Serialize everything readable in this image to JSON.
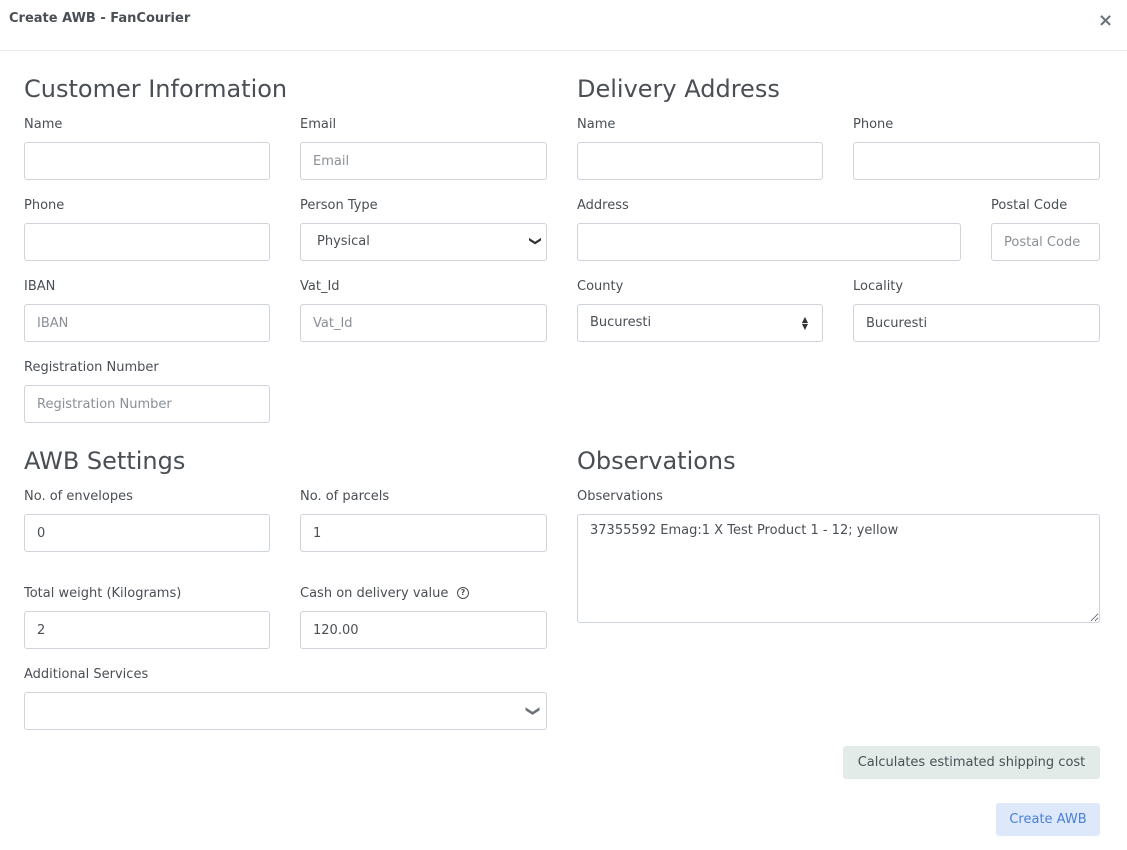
{
  "modal": {
    "title": "Create AWB - FanCourier",
    "close_icon": "×"
  },
  "customer": {
    "heading": "Customer Information",
    "name_label": "Name",
    "name_value": "",
    "email_label": "Email",
    "email_placeholder": "Email",
    "phone_label": "Phone",
    "phone_value": "",
    "person_type_label": "Person Type",
    "person_type_value": "Physical",
    "iban_label": "IBAN",
    "iban_placeholder": "IBAN",
    "vat_label": "Vat_Id",
    "vat_placeholder": "Vat_Id",
    "reg_label": "Registration Number",
    "reg_placeholder": "Registration Number"
  },
  "delivery": {
    "heading": "Delivery Address",
    "name_label": "Name",
    "name_value": "",
    "phone_label": "Phone",
    "phone_value": "",
    "address_label": "Address",
    "address_value": "",
    "postal_label": "Postal Code",
    "postal_placeholder": "Postal Code",
    "county_label": "County",
    "county_value": "Bucuresti",
    "locality_label": "Locality",
    "locality_value": "Bucuresti"
  },
  "awb": {
    "heading": "AWB Settings",
    "envelopes_label": "No. of envelopes",
    "envelopes_value": "0",
    "parcels_label": "No. of parcels",
    "parcels_value": "1",
    "weight_label": "Total weight (Kilograms)",
    "weight_value": "2",
    "cod_label": "Cash on delivery value",
    "cod_help_icon": "?",
    "cod_value": "120.00",
    "services_label": "Additional Services",
    "services_value": ""
  },
  "observations": {
    "heading": "Observations",
    "label": "Observations",
    "value": "37355592 Emag:1 X Test Product 1 - 12; yellow"
  },
  "actions": {
    "calc_label": "Calculates estimated shipping cost",
    "create_label": "Create AWB"
  },
  "icons": {
    "chevron_down": "❯",
    "select_arrows": "▲▼"
  }
}
